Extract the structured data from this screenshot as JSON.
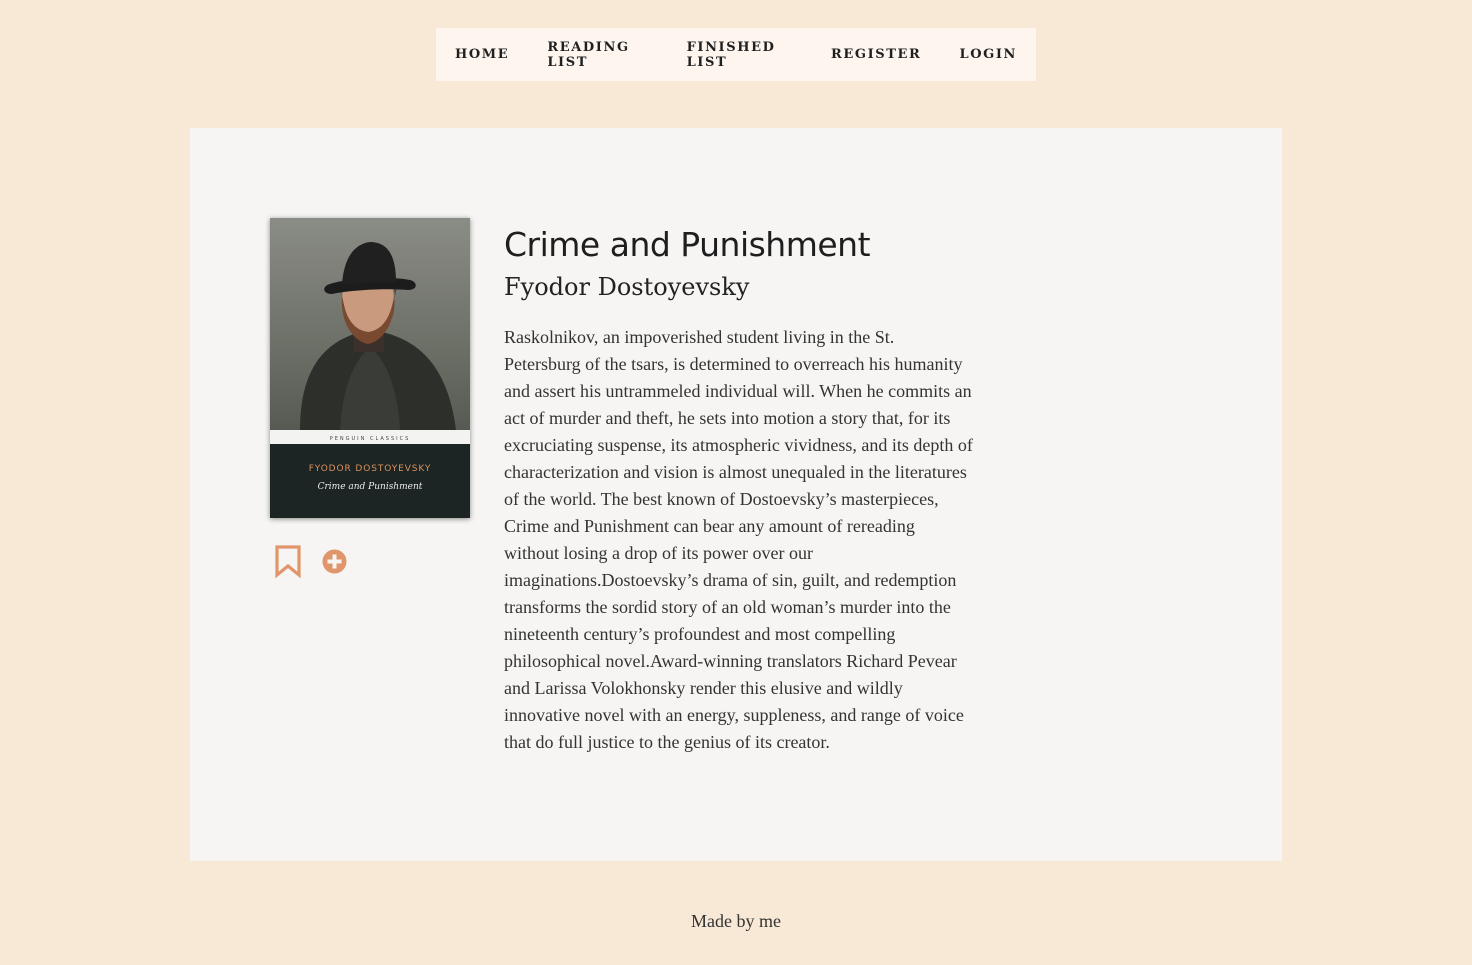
{
  "nav": {
    "items": [
      {
        "label": "HOME"
      },
      {
        "label": "READING LIST"
      },
      {
        "label": "FINISHED LIST"
      },
      {
        "label": "REGISTER"
      },
      {
        "label": "LOGIN"
      }
    ]
  },
  "book": {
    "title": "Crime and Punishment",
    "author": "Fyodor Dostoyevsky",
    "description": "Raskolnikov, an impoverished student living in the St. Petersburg of the tsars, is determined to overreach his humanity and assert his untrammeled individual will. When he commits an act of murder and theft, he sets into motion a story that, for its excruciating suspense, its atmospheric vividness, and its depth of characterization and vision is almost unequaled in the literatures of the world. The best known of Dostoevsky’s masterpieces, Crime and Punishment can bear any amount of rereading without losing a drop of its power over our imaginations.Dostoevsky’s drama of sin, guilt, and redemption transforms the sordid story of an old woman’s murder into the nineteenth century’s profoundest and most compelling philosophical novel.Award-winning translators Richard Pevear and Larissa Volokhonsky render this elusive and wildly innovative novel with an energy, suppleness, and range of voice that do full justice to the genius of its creator.",
    "cover": {
      "author_text": "FYODOR DOSTOYEVSKY",
      "title_text": "Crime and Punishment",
      "publisher_text": "PENGUIN CLASSICS"
    }
  },
  "actions": {
    "bookmark_icon": "bookmark-icon",
    "add_icon": "plus-circle-icon",
    "accent_color": "#e0966a"
  },
  "footer": {
    "text": "Made by me"
  }
}
